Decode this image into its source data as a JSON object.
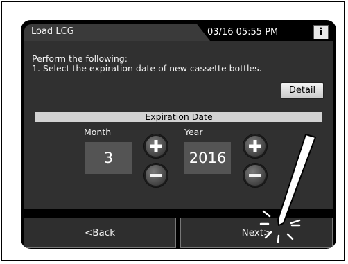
{
  "titlebar": {
    "title": "Load LCG",
    "datetime": "03/16 05:55 PM",
    "info_icon": "info-icon",
    "info_label": "i"
  },
  "content": {
    "instruction_line1": "Perform the following:",
    "instruction_line2": "1. Select the expiration date of new cassette bottles.",
    "detail_label": "Detail",
    "section_header": "Expiration Date",
    "month": {
      "label": "Month",
      "value": "3"
    },
    "year": {
      "label": "Year",
      "value": "2016"
    },
    "increment_icon": "plus-icon",
    "decrement_icon": "minus-icon"
  },
  "bottombar": {
    "back_label": "<Back",
    "next_label": "Next>"
  },
  "colors": {
    "screen_bg": "#000000",
    "panel_bg": "#303030",
    "value_box_bg": "#545454",
    "header_bar_bg": "#d2d2d2"
  }
}
